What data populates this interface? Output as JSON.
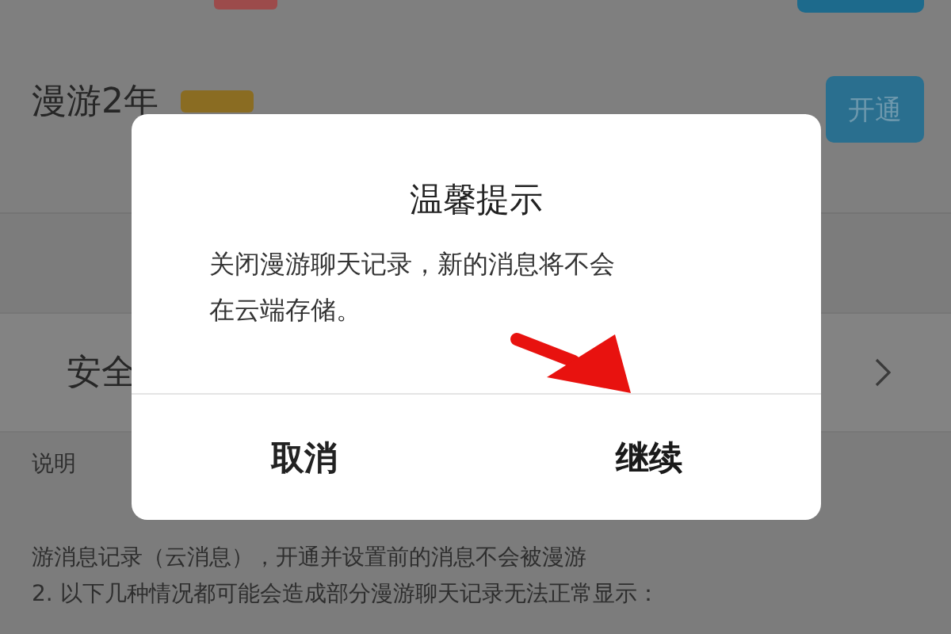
{
  "background_page": {
    "plans": [
      {
        "name": "漫游2年",
        "button": "开通"
      }
    ],
    "security_row": {
      "label": "安全"
    },
    "notes": {
      "heading": "说明",
      "lines": [
        "游消息记录（云消息），开通并设置前的消息不会被漫游",
        "2. 以下几种情况都可能会造成部分漫游聊天记录无法正常显示："
      ]
    }
  },
  "dialog": {
    "title": "温馨提示",
    "message": "关闭漫游聊天记录，新的消息将不会在云端存储。",
    "buttons": [
      {
        "label": "取消",
        "kind": "cancel"
      },
      {
        "label": "继续",
        "kind": "confirm"
      }
    ]
  }
}
